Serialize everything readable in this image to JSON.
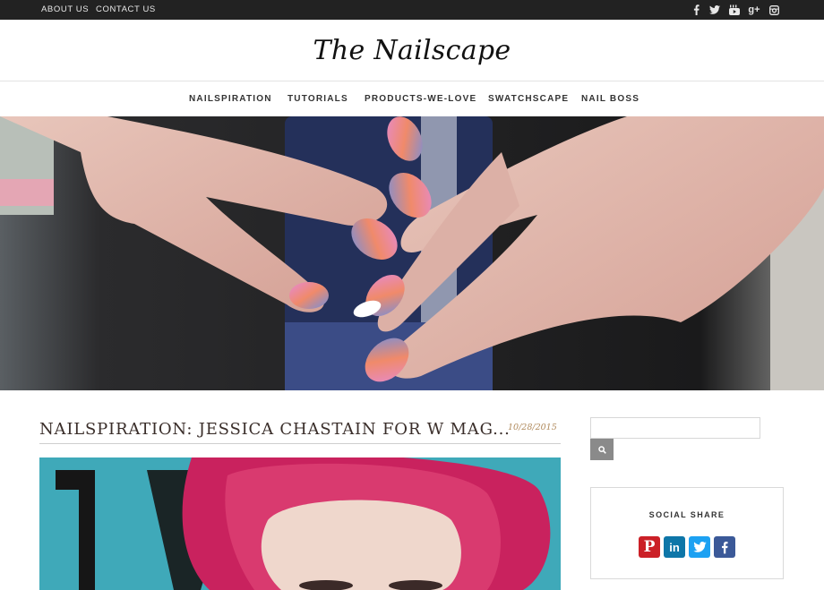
{
  "topbar": {
    "links": [
      "ABOUT US",
      "CONTACT US"
    ],
    "social_icons": [
      "facebook-icon",
      "twitter-icon",
      "youtube-icon",
      "google-plus-icon",
      "instagram-icon"
    ],
    "background": "#222222"
  },
  "site": {
    "title": "The Nailscape"
  },
  "nav": {
    "items": [
      "NAILSPIRATION",
      "TUTORIALS",
      "PRODUCTS-WE-LOVE",
      "SWATCHSCAPE",
      "NAIL BOSS"
    ]
  },
  "hero": {
    "image_alt": "hands with marbled pink, blue and coral nail art holding a water bottle"
  },
  "post": {
    "title": "NAILSPIRATION: JESSICA CHASTAIN FOR W MAG...",
    "date": "10/28/2015"
  },
  "sidebar": {
    "search": {
      "value": "",
      "button_icon": "search-icon"
    },
    "social_share": {
      "title": "SOCIAL SHARE",
      "buttons": [
        {
          "icon": "pinterest-icon",
          "color": "#cb2027"
        },
        {
          "icon": "linkedin-icon",
          "color": "#0e76a8"
        },
        {
          "icon": "twitter-icon",
          "color": "#1da1f2"
        },
        {
          "icon": "facebook-icon",
          "color": "#3b5998"
        }
      ]
    }
  },
  "colors": {
    "accent": "#b08a5c",
    "text": "#3a2e2a",
    "nav_text": "#333333"
  }
}
